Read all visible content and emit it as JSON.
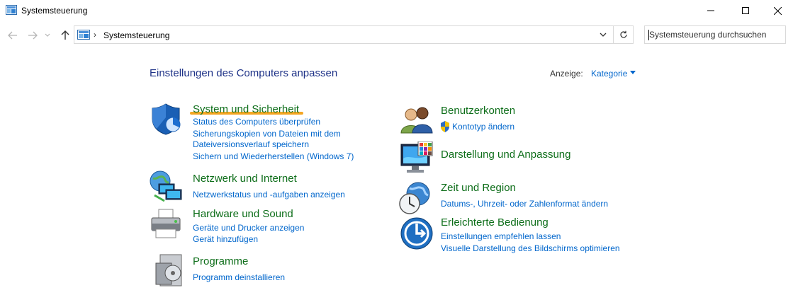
{
  "window": {
    "title": "Systemsteuerung"
  },
  "address": {
    "path": "Systemsteuerung",
    "separator": "›"
  },
  "search": {
    "placeholder": "Systemsteuerung durchsuchen"
  },
  "heading": "Einstellungen des Computers anpassen",
  "view": {
    "label": "Anzeige:",
    "value": "Kategorie"
  },
  "categories": {
    "system": {
      "title": "System und Sicherheit",
      "links": [
        "Status des Computers überprüfen",
        "Sicherungskopien von Dateien mit dem",
        "Dateiversionsverlauf speichern",
        "Sichern und Wiederherstellen (Windows 7)"
      ]
    },
    "network": {
      "title": "Netzwerk und Internet",
      "links": [
        "Netzwerkstatus und -aufgaben anzeigen"
      ]
    },
    "hardware": {
      "title": "Hardware und Sound",
      "links": [
        "Geräte und Drucker anzeigen",
        "Gerät hinzufügen"
      ]
    },
    "programs": {
      "title": "Programme",
      "links": [
        "Programm deinstallieren"
      ]
    },
    "users": {
      "title": "Benutzerkonten",
      "links": [
        "Kontotyp ändern"
      ]
    },
    "appearance": {
      "title": "Darstellung und Anpassung",
      "links": []
    },
    "clock": {
      "title": "Zeit und Region",
      "links": [
        "Datums-, Uhrzeit- oder Zahlenformat ändern"
      ]
    },
    "access": {
      "title": "Erleichterte Bedienung",
      "links": [
        "Einstellungen empfehlen lassen",
        "Visuelle Darstellung des Bildschirms optimieren"
      ]
    }
  },
  "colors": {
    "heading": "#1e3287",
    "category": "#0e6e1a",
    "link": "#0066cc",
    "highlight": "#f5a623"
  },
  "icons": [
    "control-panel-icon",
    "minimize-icon",
    "maximize-icon",
    "close-icon",
    "back-arrow-icon",
    "forward-arrow-icon",
    "recent-chevron-icon",
    "up-arrow-icon",
    "chevron-down-icon",
    "refresh-icon",
    "shield-icon",
    "network-globe-icon",
    "printer-icon",
    "programs-disc-icon",
    "users-icon",
    "uac-shield-icon",
    "monitor-palette-icon",
    "clock-globe-icon",
    "ease-of-access-icon"
  ]
}
